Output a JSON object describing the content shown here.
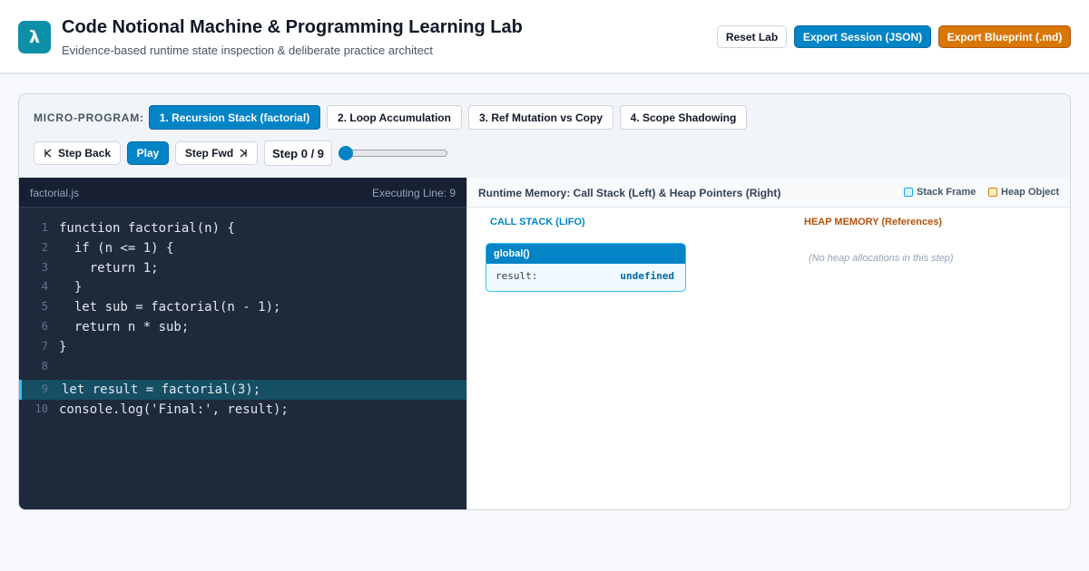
{
  "app": {
    "logo_glyph": "λ",
    "title": "Code Notional Machine & Programming Learning Lab",
    "subtitle": "Evidence-based runtime state inspection & deliberate practice architect",
    "accent": "#0284c7",
    "warning": "#d97706"
  },
  "header": {
    "reset_label": "Reset Lab",
    "export_session_label": "Export Session (JSON)",
    "export_blueprint_label": "Export Blueprint (.md)"
  },
  "programs": {
    "label": "MICRO-PROGRAM:",
    "items": [
      {
        "label": "1. Recursion Stack (factorial)",
        "active": true
      },
      {
        "label": "2. Loop Accumulation",
        "active": false
      },
      {
        "label": "3. Ref Mutation vs Copy",
        "active": false
      },
      {
        "label": "4. Scope Shadowing",
        "active": false
      }
    ]
  },
  "controls": {
    "step_back_label": "Step Back",
    "step_back_icon": "skip-back-icon",
    "play_label": "Play",
    "step_fwd_label": "Step Fwd",
    "step_fwd_icon": "skip-forward-icon",
    "step_indicator": "Step 0 / 9",
    "step_current": 0,
    "step_total": 9
  },
  "code": {
    "filename": "factorial.js",
    "executing": "Executing Line: 9",
    "highlight_line": 9,
    "lines": [
      {
        "n": "1",
        "text": "function factorial(n) {"
      },
      {
        "n": "2",
        "text": "  if (n <= 1) {"
      },
      {
        "n": "3",
        "text": "    return 1;"
      },
      {
        "n": "4",
        "text": "  }"
      },
      {
        "n": "5",
        "text": "  let sub = factorial(n - 1);"
      },
      {
        "n": "6",
        "text": "  return n * sub;"
      },
      {
        "n": "7",
        "text": "}"
      },
      {
        "n": "8",
        "text": ""
      },
      {
        "n": "9",
        "text": "let result = factorial(3);"
      },
      {
        "n": "10",
        "text": "console.log('Final:', result);"
      }
    ]
  },
  "memory": {
    "title": "Runtime Memory: Call Stack (Left) & Heap Pointers (Right)",
    "legend_stack": "Stack Frame",
    "legend_heap": "Heap Object",
    "stack_header": "CALL STACK (LIFO)",
    "heap_header": "HEAP MEMORY (References)",
    "frames": [
      {
        "name": "global()",
        "vars": [
          {
            "name": "result:",
            "value": "undefined"
          }
        ]
      }
    ],
    "heap_empty": "(No heap allocations in this step)"
  }
}
